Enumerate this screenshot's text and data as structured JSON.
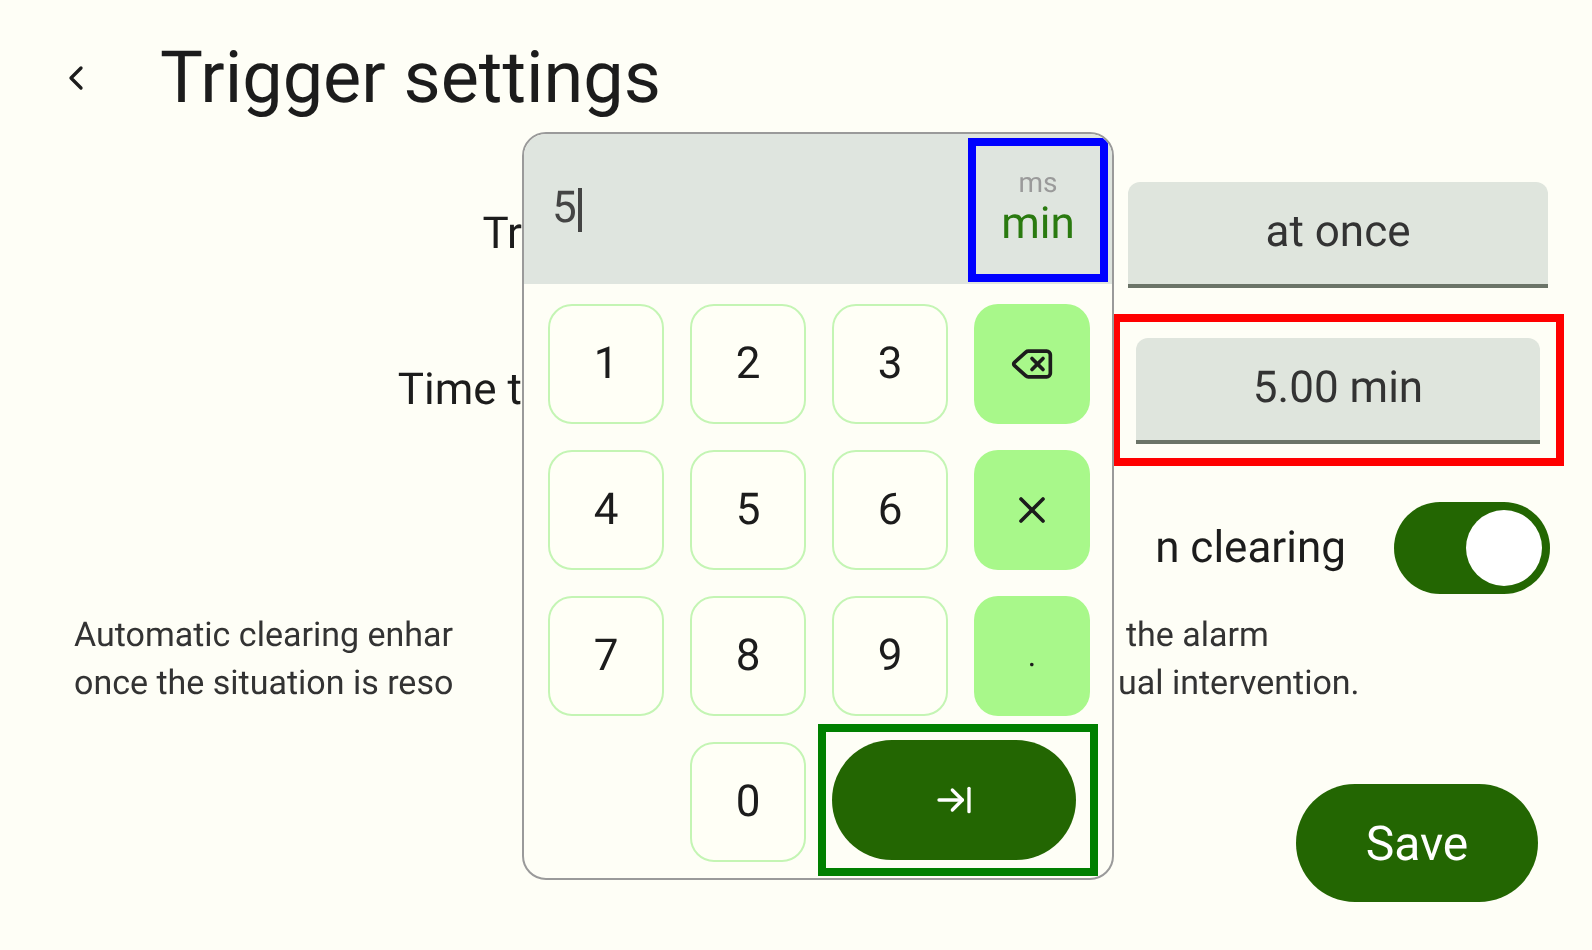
{
  "header": {
    "title": "Trigger settings"
  },
  "rows": [
    {
      "kind": "field",
      "label": "Tr",
      "value": "at once"
    },
    {
      "kind": "field",
      "label": "Time t",
      "value": "5.00 min",
      "highlighted": true
    },
    {
      "kind": "toggle",
      "label": "n clearing",
      "on": true
    }
  ],
  "description": [
    {
      "left": "Automatic clearing enhar",
      "right": "the alarm"
    },
    {
      "left": "once the situation is reso",
      "right": "ual intervention."
    }
  ],
  "save_button": "Save",
  "keypad": {
    "value": "5",
    "units": [
      {
        "label": "ms",
        "selected": false
      },
      {
        "label": "min",
        "selected": true
      }
    ],
    "unit_highlighted": true,
    "enter_highlighted": true,
    "keys": [
      {
        "kind": "digit",
        "label": "1"
      },
      {
        "kind": "digit",
        "label": "2"
      },
      {
        "kind": "digit",
        "label": "3"
      },
      {
        "kind": "backspace"
      },
      {
        "kind": "digit",
        "label": "4"
      },
      {
        "kind": "digit",
        "label": "5"
      },
      {
        "kind": "digit",
        "label": "6"
      },
      {
        "kind": "clear"
      },
      {
        "kind": "digit",
        "label": "7"
      },
      {
        "kind": "digit",
        "label": "8"
      },
      {
        "kind": "digit",
        "label": "9"
      },
      {
        "kind": "dot",
        "label": "."
      },
      {
        "kind": "empty"
      },
      {
        "kind": "digit",
        "label": "0"
      },
      {
        "kind": "enter"
      }
    ]
  }
}
